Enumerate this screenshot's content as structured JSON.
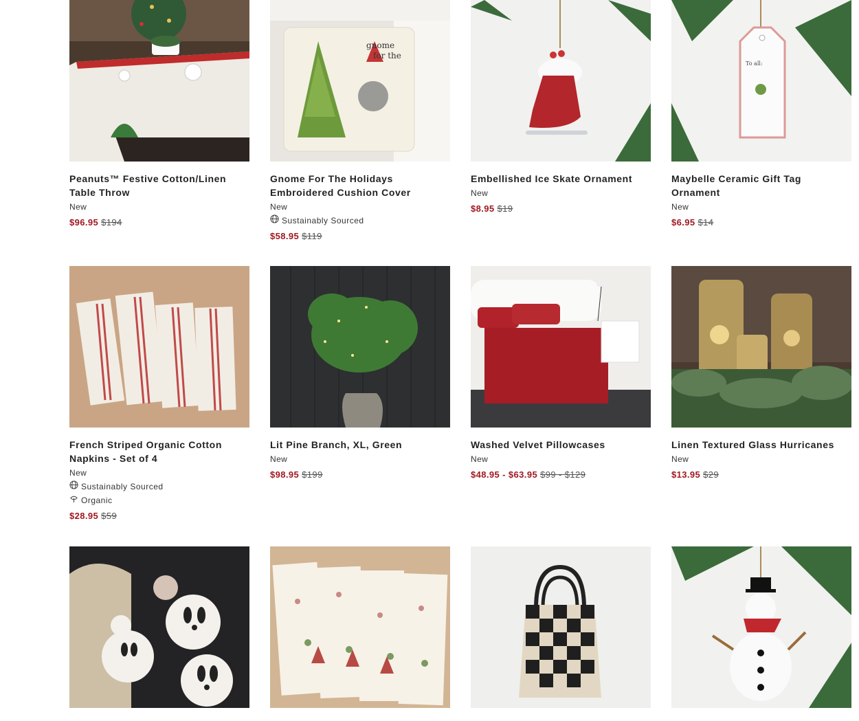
{
  "products": [
    {
      "title": "Peanuts™ Festive Cotton/Linen Table Throw",
      "badge": "New",
      "sale": "$96.95",
      "orig": "$194"
    },
    {
      "title": "Gnome For The Holidays Embroidered Cushion Cover",
      "badge": "New",
      "attr1": "Sustainably Sourced",
      "sale": "$58.95",
      "orig": "$119"
    },
    {
      "title": "Embellished Ice Skate Ornament",
      "badge": "New",
      "sale": "$8.95",
      "orig": "$19"
    },
    {
      "title": "Maybelle Ceramic Gift Tag Ornament",
      "badge": "New",
      "sale": "$6.95",
      "orig": "$14"
    },
    {
      "title": "French Striped Organic Cotton Napkins - Set of 4",
      "badge": "New",
      "attr1": "Sustainably Sourced",
      "attr2": "Organic",
      "sale": "$28.95",
      "orig": "$59"
    },
    {
      "title": "Lit Pine Branch, XL, Green",
      "badge": "New",
      "sale": "$98.95",
      "orig": "$199"
    },
    {
      "title": "Washed Velvet Pillowcases",
      "badge": "New",
      "sale": "$48.95 - $63.95",
      "orig": "$99 - $129"
    },
    {
      "title": "Linen Textured Glass Hurricanes",
      "badge": "New",
      "sale": "$13.95",
      "orig": "$29"
    }
  ],
  "colors": {
    "sale": "#a01720",
    "text": "#222222"
  },
  "icons": {
    "sustainable": "globe-icon",
    "organic": "leaf-icon"
  }
}
